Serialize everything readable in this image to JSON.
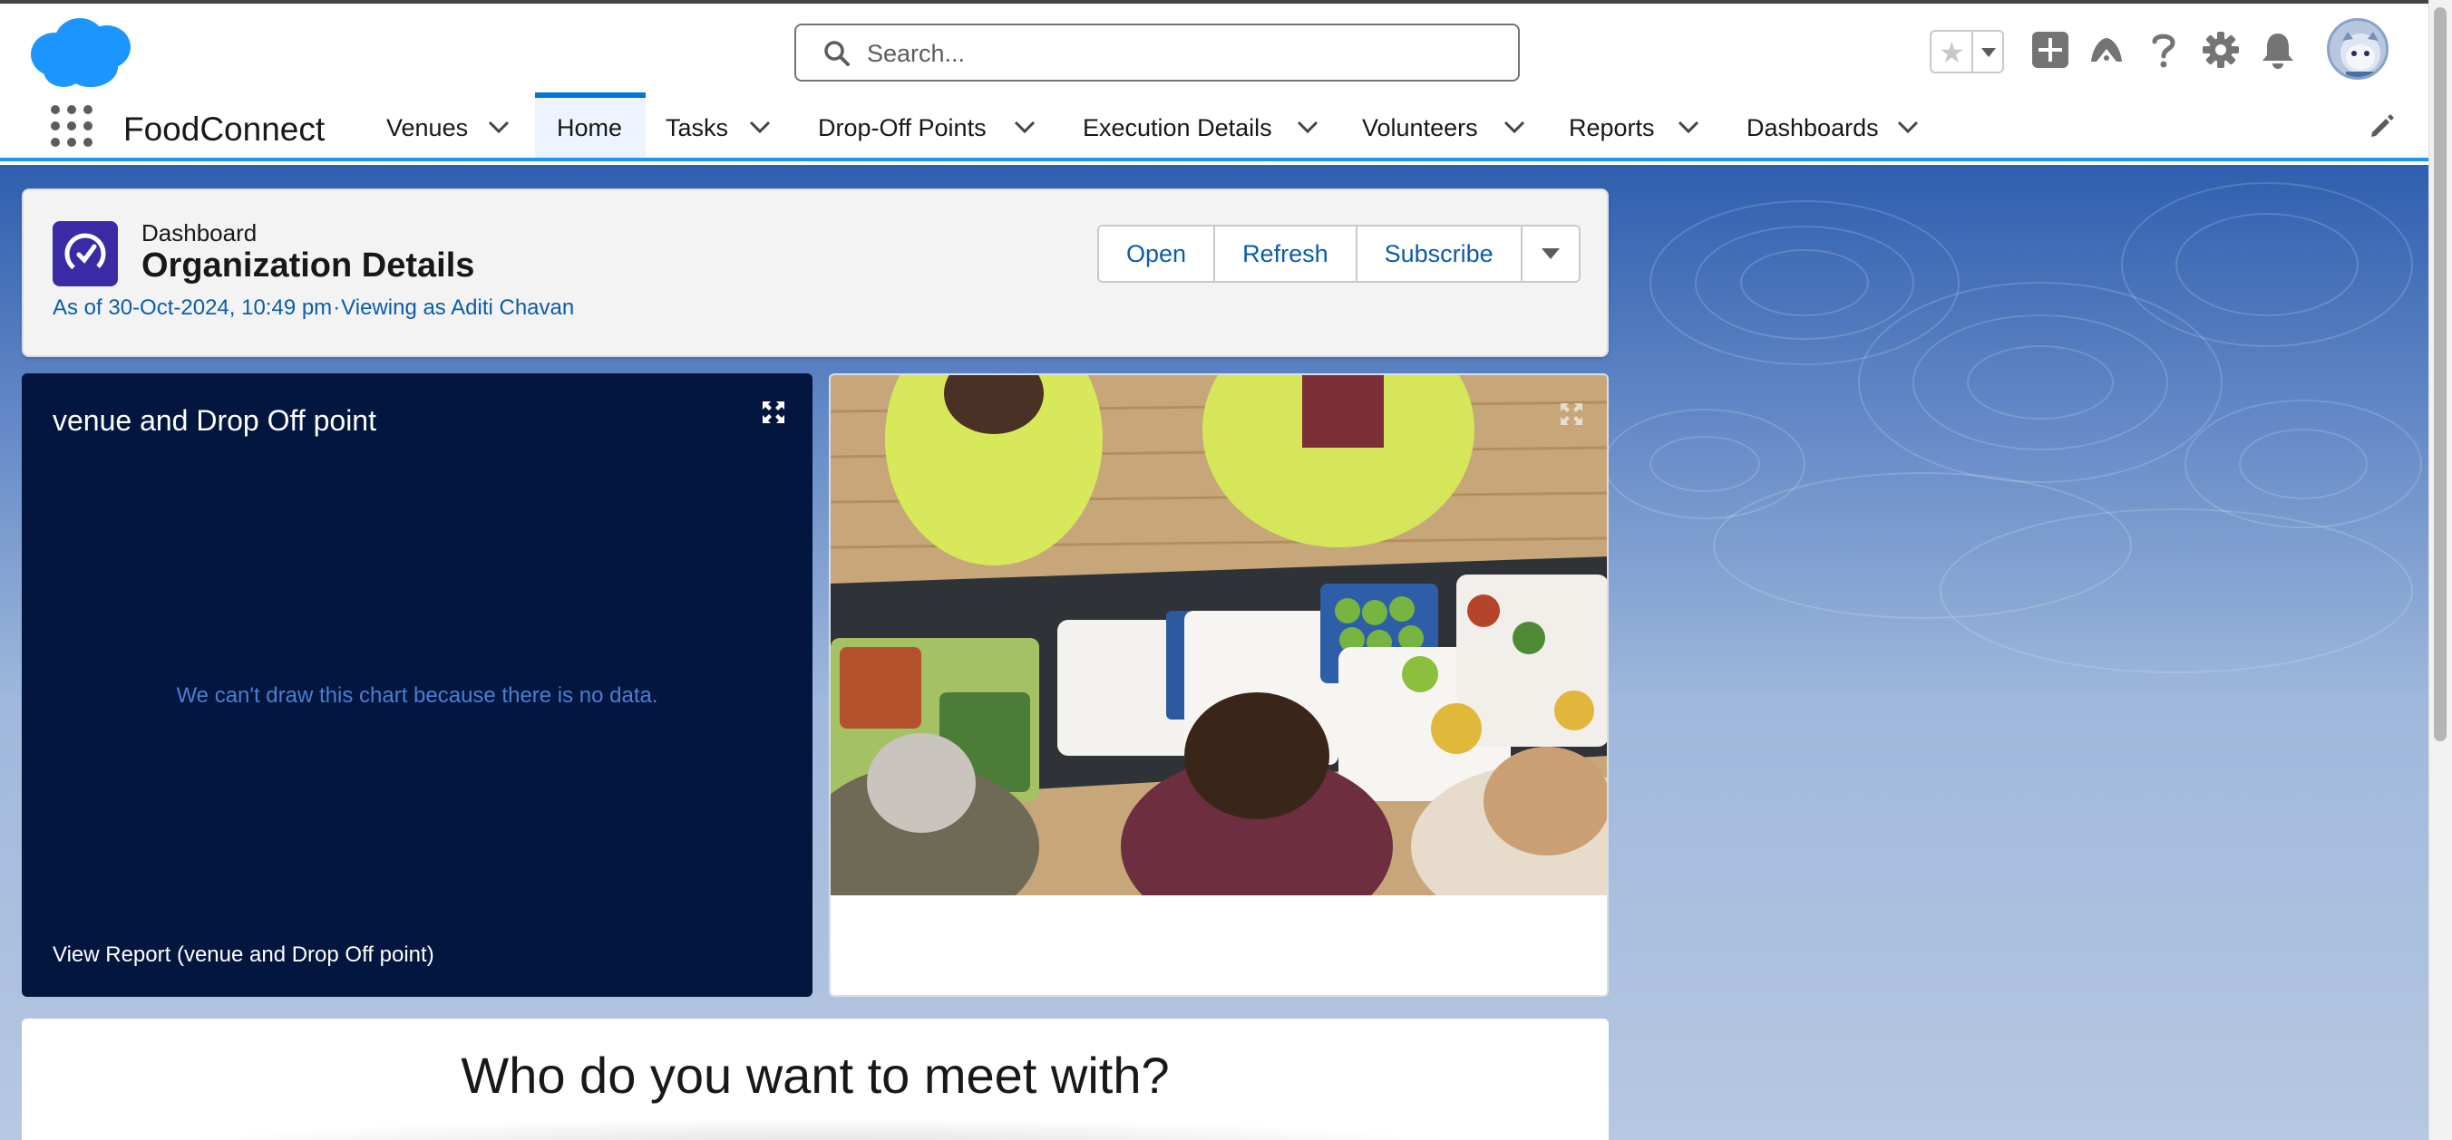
{
  "header": {
    "search_placeholder": "Search...",
    "icons": [
      "favorites-star-icon",
      "add-icon",
      "trailhead-icon",
      "help-icon",
      "setup-gear-icon",
      "notifications-bell-icon",
      "user-avatar"
    ]
  },
  "nav": {
    "app_name": "FoodConnect",
    "items": [
      {
        "label": "Venues",
        "has_menu": true,
        "active": false
      },
      {
        "label": "Home",
        "has_menu": false,
        "active": true
      },
      {
        "label": "Tasks",
        "has_menu": true,
        "active": false
      },
      {
        "label": "Drop-Off Points",
        "has_menu": true,
        "active": false
      },
      {
        "label": "Execution Details",
        "has_menu": true,
        "active": false
      },
      {
        "label": "Volunteers",
        "has_menu": true,
        "active": false
      },
      {
        "label": "Reports",
        "has_menu": true,
        "active": false
      },
      {
        "label": "Dashboards",
        "has_menu": true,
        "active": false
      }
    ]
  },
  "dashboard": {
    "label": "Dashboard",
    "title": "Organization Details",
    "as_of": "As of 30-Oct-2024, 10:49 pm",
    "separator": "·",
    "viewing_as": "Viewing as Aditi Chavan",
    "buttons": {
      "open": "Open",
      "refresh": "Refresh",
      "subscribe": "Subscribe"
    }
  },
  "chart_widget": {
    "title": "venue and Drop Off point",
    "no_data_message": "We can't draw this chart because there is no data.",
    "view_report": "View Report (venue and Drop Off point)"
  },
  "meet_card": {
    "title": "Who do you want to meet with?"
  },
  "colors": {
    "accent": "#0176d3",
    "link": "#0b5cab",
    "chart_bg": "#03163f",
    "dashboard_icon": "#3a2aa5",
    "logo": "#1b96ff"
  }
}
